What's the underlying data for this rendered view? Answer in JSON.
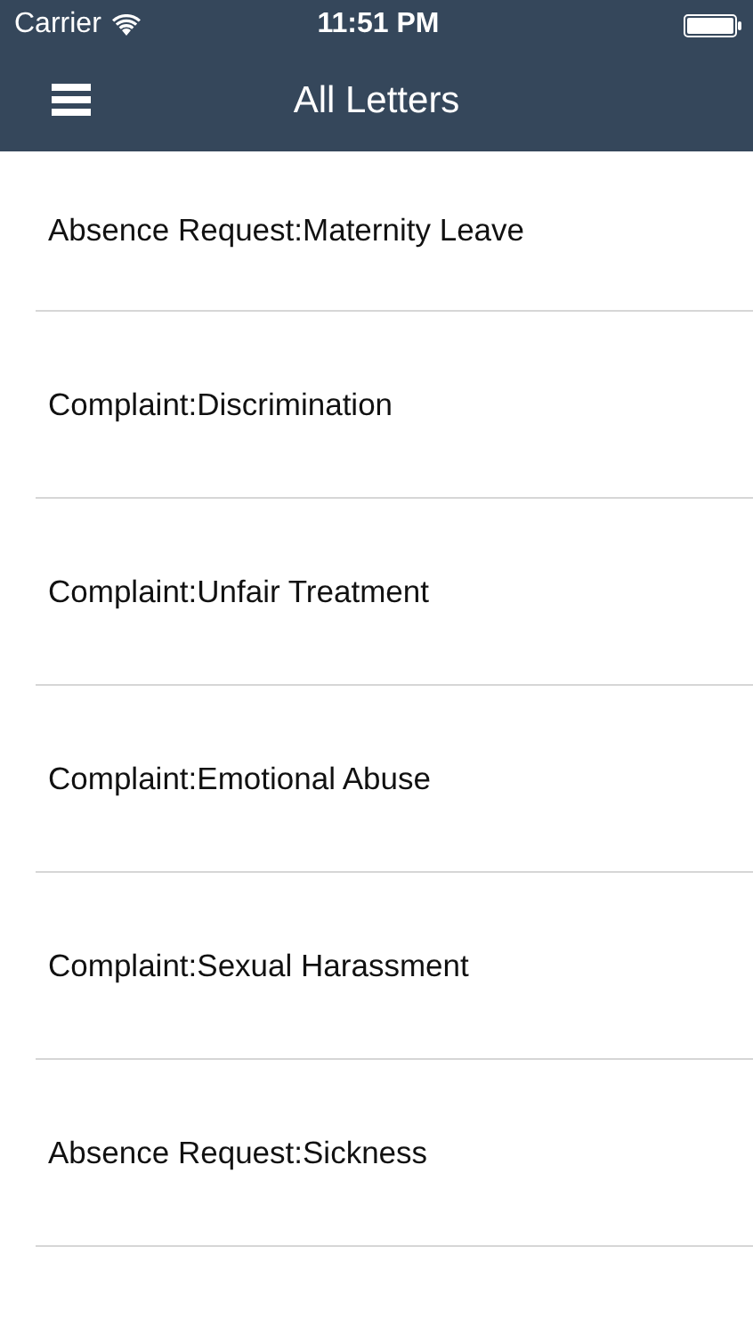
{
  "status_bar": {
    "carrier": "Carrier",
    "time": "11:51 PM"
  },
  "nav_bar": {
    "title": "All Letters"
  },
  "letters": [
    {
      "title": "Absence Request:Maternity Leave"
    },
    {
      "title": "Complaint:Discrimination"
    },
    {
      "title": "Complaint:Unfair Treatment"
    },
    {
      "title": "Complaint:Emotional Abuse"
    },
    {
      "title": "Complaint:Sexual Harassment"
    },
    {
      "title": "Absence Request:Sickness"
    }
  ]
}
